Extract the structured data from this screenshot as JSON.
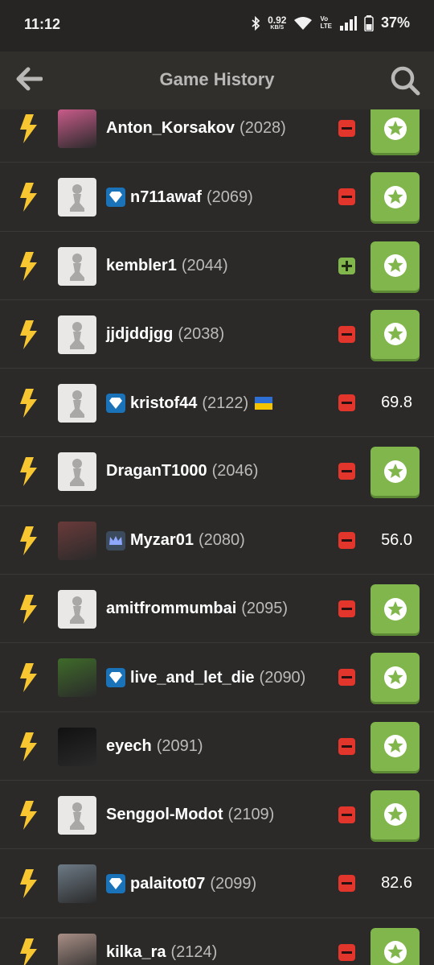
{
  "status_bar": {
    "time": "11:12",
    "net_speed": "0.92",
    "net_unit": "KB/S",
    "volte_top": "Vo",
    "volte_bottom": "LTE",
    "battery": "37%"
  },
  "header": {
    "title": "Game History"
  },
  "colors": {
    "background": "#2b2a28",
    "win": "#81b64c",
    "loss": "#e2352c",
    "bolt": "#f7c631",
    "diamond_badge": "#1a72b8"
  },
  "games": [
    {
      "username": "Anton_Korsakov",
      "rating": "(2028)",
      "badge": "",
      "avatar": "photo",
      "result": "loss",
      "accuracy": "",
      "flag": ""
    },
    {
      "username": "n711awaf",
      "rating": "(2069)",
      "badge": "diamond",
      "avatar": "pawn",
      "result": "loss",
      "accuracy": "",
      "flag": ""
    },
    {
      "username": "kembler1",
      "rating": "(2044)",
      "badge": "",
      "avatar": "pawn",
      "result": "win",
      "accuracy": "",
      "flag": ""
    },
    {
      "username": "jjdjddjgg",
      "rating": "(2038)",
      "badge": "",
      "avatar": "pawn",
      "result": "loss",
      "accuracy": "",
      "flag": ""
    },
    {
      "username": "kristof44",
      "rating": "(2122)",
      "badge": "diamond",
      "avatar": "pawn",
      "result": "loss",
      "accuracy": "69.8",
      "flag": "ukraine"
    },
    {
      "username": "DraganT1000",
      "rating": "(2046)",
      "badge": "",
      "avatar": "pawn",
      "result": "loss",
      "accuracy": "",
      "flag": ""
    },
    {
      "username": "Myzar01",
      "rating": "(2080)",
      "badge": "crown",
      "avatar": "photo",
      "result": "loss",
      "accuracy": "56.0",
      "flag": ""
    },
    {
      "username": "amitfrommumbai",
      "rating": "(2095)",
      "badge": "",
      "avatar": "pawn",
      "result": "loss",
      "accuracy": "",
      "flag": ""
    },
    {
      "username": "live_and_let_die",
      "rating": "(2090)",
      "badge": "diamond",
      "avatar": "photo",
      "result": "loss",
      "accuracy": "",
      "flag": ""
    },
    {
      "username": "eyech",
      "rating": "(2091)",
      "badge": "",
      "avatar": "photo",
      "result": "loss",
      "accuracy": "",
      "flag": ""
    },
    {
      "username": "Senggol-Modot",
      "rating": "(2109)",
      "badge": "",
      "avatar": "pawn",
      "result": "loss",
      "accuracy": "",
      "flag": ""
    },
    {
      "username": "palaitot07",
      "rating": "(2099)",
      "badge": "diamond",
      "avatar": "photo",
      "result": "loss",
      "accuracy": "82.6",
      "flag": ""
    },
    {
      "username": "kilka_ra",
      "rating": "(2124)",
      "badge": "",
      "avatar": "photo",
      "result": "loss",
      "accuracy": "",
      "flag": ""
    }
  ]
}
